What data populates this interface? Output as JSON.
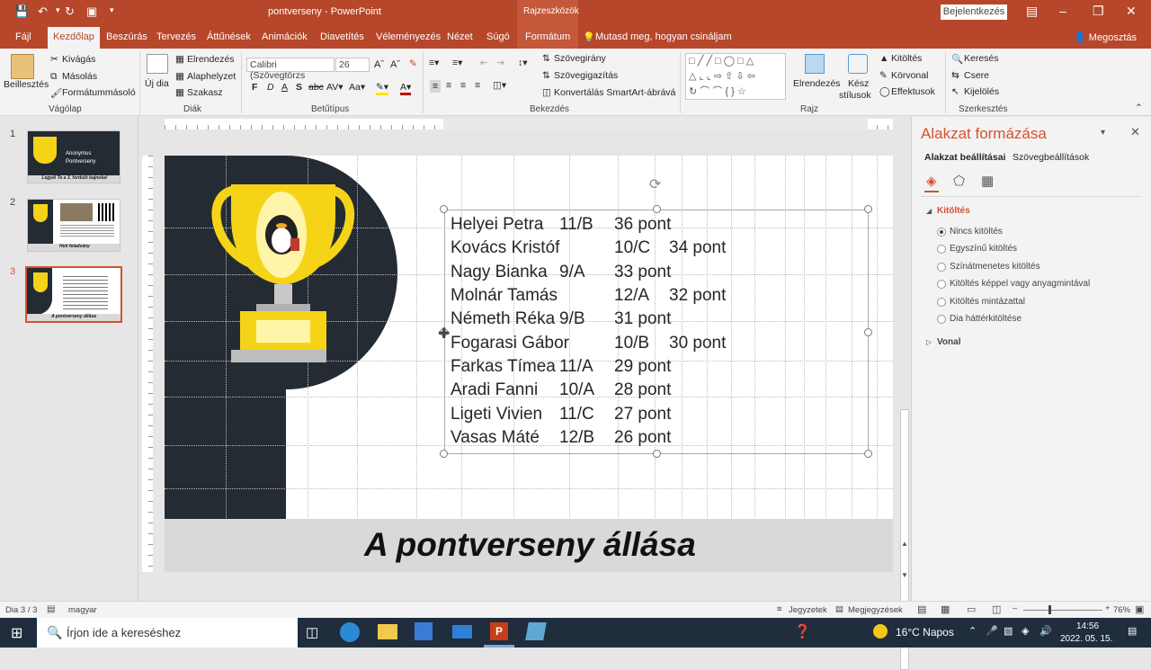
{
  "window": {
    "title": "pontverseny  -  PowerPoint",
    "context_label": "Rajzeszközök",
    "signin_label": "Bejelentkezés"
  },
  "tabs": [
    {
      "label": "Fájl"
    },
    {
      "label": "Kezdőlap"
    },
    {
      "label": "Beszúrás"
    },
    {
      "label": "Tervezés"
    },
    {
      "label": "Áttűnések"
    },
    {
      "label": "Animációk"
    },
    {
      "label": "Diavetítés"
    },
    {
      "label": "Véleményezés"
    },
    {
      "label": "Nézet"
    },
    {
      "label": "Súgó"
    },
    {
      "label": "Formátum"
    }
  ],
  "tell_me": "Mutasd meg, hogyan csináljam",
  "share_label": "Megosztás",
  "ribbon": {
    "clipboard": {
      "paste": "Beillesztés",
      "cut": "Kivágás",
      "copy": "Másolás",
      "painter": "Formátummásoló",
      "group": "Vágólap"
    },
    "slides": {
      "new": "Új dia",
      "layout": "Elrendezés",
      "reset": "Alaphelyzet",
      "section": "Szakasz",
      "group": "Diák"
    },
    "font": {
      "name": "Calibri (Szövegtörzs",
      "size": "26",
      "group": "Betűtípus",
      "bold": "F",
      "italic": "D",
      "underline": "A",
      "shadow": "S",
      "strike": "abc"
    },
    "paragraph": {
      "direction": "Szövegirány",
      "align": "Szövegigazítás",
      "smartart": "Konvertálás SmartArt-ábrává",
      "group": "Bekezdés"
    },
    "drawing": {
      "arrange": "Elrendezés",
      "quick1": "Kész",
      "quick2": "stílusok",
      "fill": "Kitöltés",
      "outline": "Körvonal",
      "effects": "Effektusok",
      "group": "Rajz"
    },
    "editing": {
      "find": "Keresés",
      "replace": "Csere",
      "select": "Kijelölés",
      "group": "Szerkesztés"
    }
  },
  "slides": [
    {
      "num": "1",
      "line1": "Anonymus",
      "line2": "Pontverseny",
      "caption": "Legyél Te a 3. forduló bajnoka!"
    },
    {
      "num": "2",
      "caption": "Heti feladvány"
    },
    {
      "num": "3",
      "caption": "A pontverseny állása"
    }
  ],
  "slide": {
    "rows": [
      {
        "name": "Helyei Petra",
        "class": "11/B",
        "points": "36 pont"
      },
      {
        "name": "Kovács Kristóf",
        "class": "10/C",
        "points": "34 pont"
      },
      {
        "name": "Nagy Bianka",
        "class": "9/A",
        "points": "33 pont"
      },
      {
        "name": "Molnár Tamás",
        "class": "12/A",
        "points": "32 pont"
      },
      {
        "name": "Németh Réka",
        "class": "9/B",
        "points": "31 pont"
      },
      {
        "name": "Fogarasi Gábor",
        "class": "10/B",
        "points": "30 pont"
      },
      {
        "name": "Farkas Tímea",
        "class": "11/A",
        "points": "29 pont"
      },
      {
        "name": "Aradi Fanni",
        "class": "10/A",
        "points": "28 pont"
      },
      {
        "name": "Ligeti Vivien",
        "class": "11/C",
        "points": "27 pont"
      },
      {
        "name": "Vasas Máté",
        "class": "12/B",
        "points": "26 pont"
      }
    ],
    "title": "A pontverseny állása"
  },
  "pane": {
    "title": "Alakzat formázása",
    "tab_shape": "Alakzat beállításai",
    "tab_text": "Szövegbeállítások",
    "section_fill": "Kitöltés",
    "options": [
      {
        "label": "Nincs kitöltés",
        "selected": true
      },
      {
        "label": "Egyszínű kitöltés",
        "selected": false
      },
      {
        "label": "Színátmenetes kitöltés",
        "selected": false
      },
      {
        "label": "Kitöltés képpel vagy anyagmintával",
        "selected": false
      },
      {
        "label": "Kitöltés mintázattal",
        "selected": false
      },
      {
        "label": "Dia háttérkitöltése",
        "selected": false
      }
    ],
    "section_line": "Vonal"
  },
  "status": {
    "slide_info": "Dia 3 / 3",
    "language": "magyar",
    "notes": "Jegyzetek",
    "comments": "Megjegyzések",
    "zoom": "76%",
    "zoom_level": 0.58
  },
  "taskbar": {
    "search_placeholder": "Írjon ide a kereséshez",
    "weather": "16°C  Napos",
    "time": "14:56",
    "date": "2022. 05. 15."
  },
  "colors": {
    "accent": "#b7472a",
    "slide_dark": "#252b33",
    "trophy": "#f5d418"
  }
}
